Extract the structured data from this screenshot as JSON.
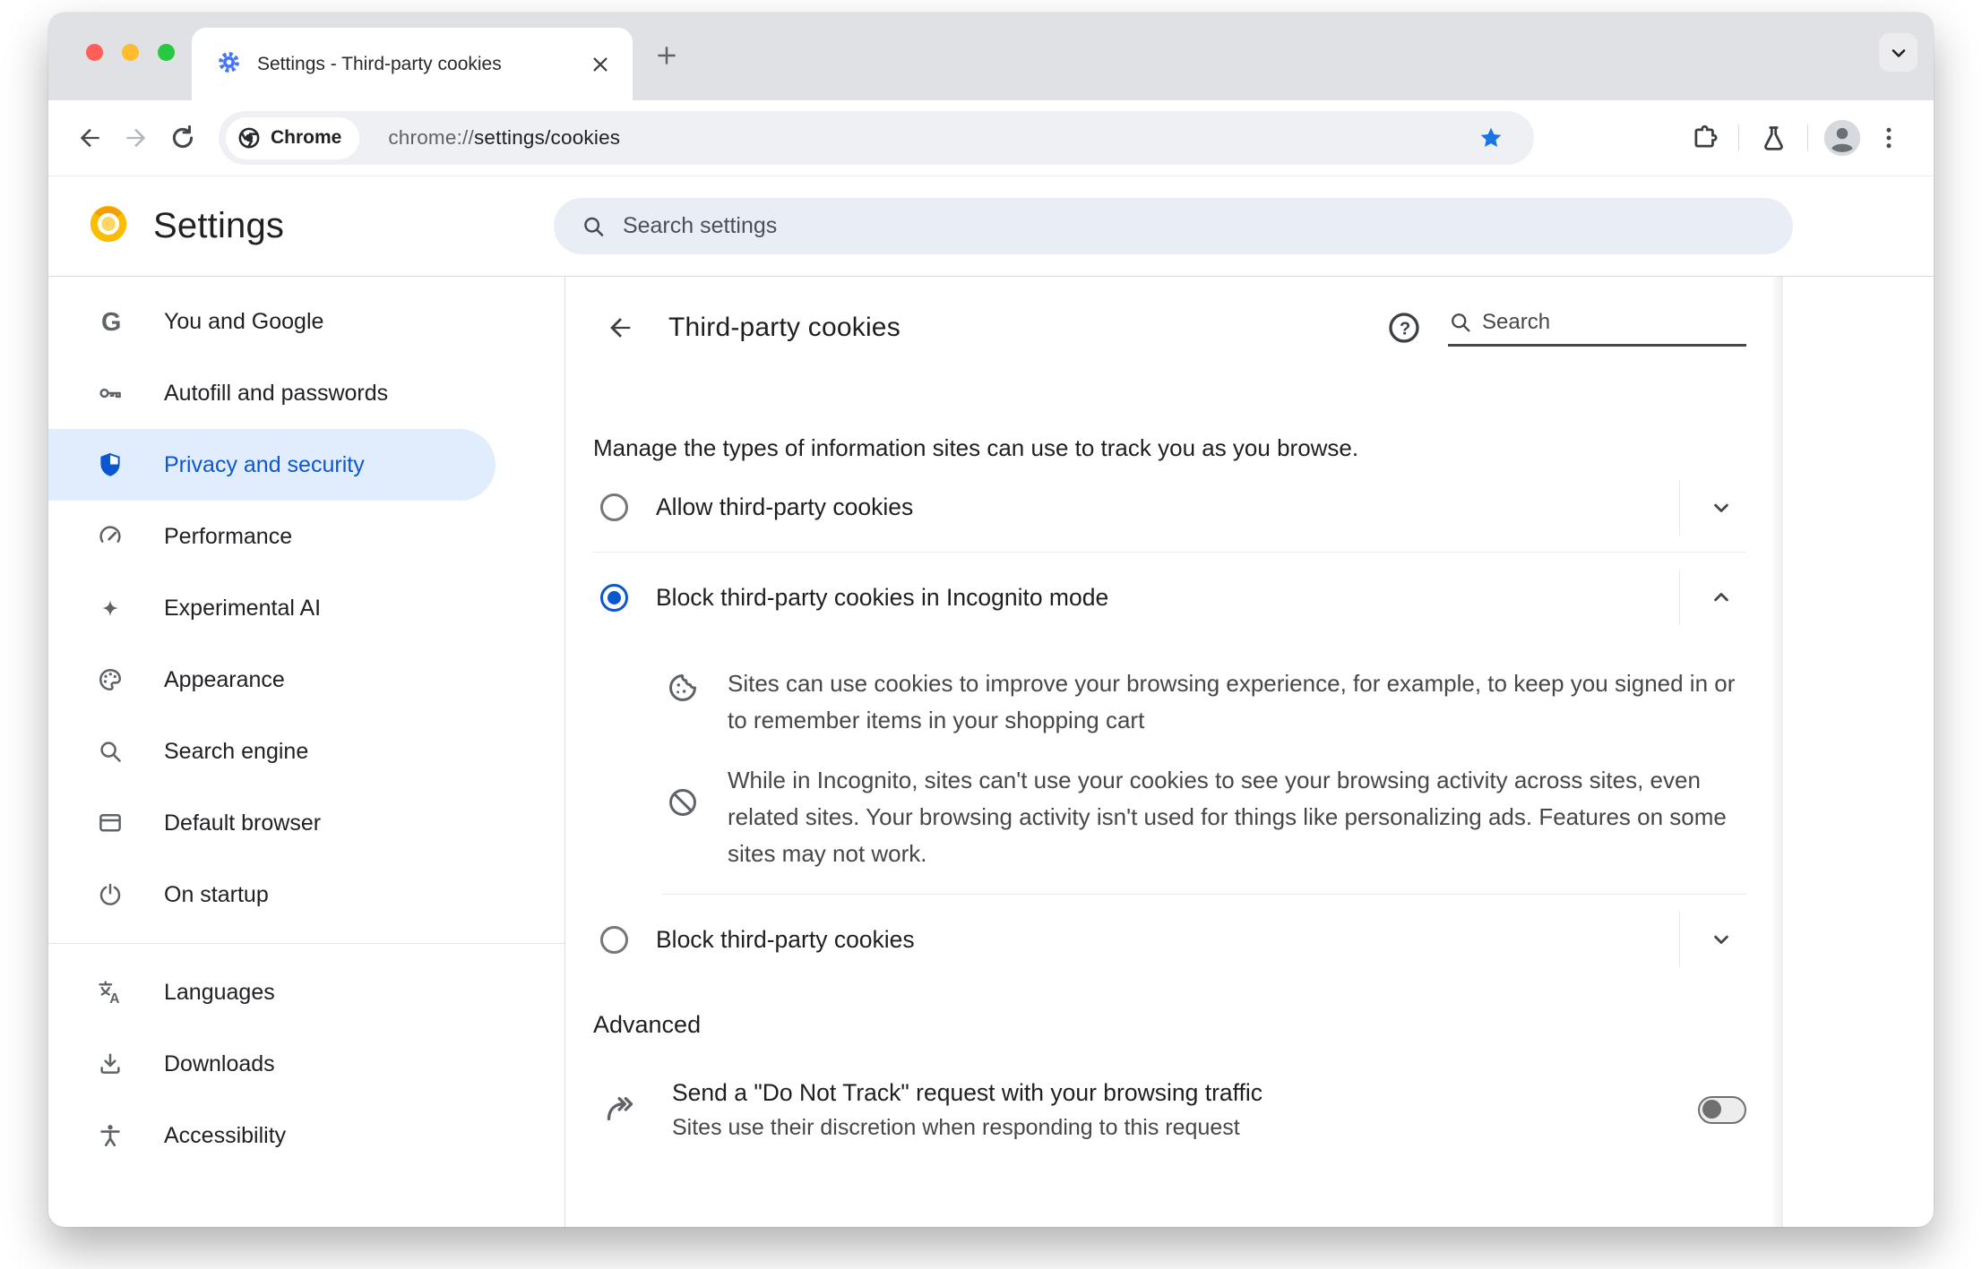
{
  "browser": {
    "tab_title": "Settings - Third-party cookies",
    "chrome_chip_label": "Chrome",
    "url_scheme": "chrome://",
    "url_path": "settings/cookies"
  },
  "settings_header": {
    "title": "Settings",
    "search_placeholder": "Search settings"
  },
  "sidebar": {
    "items": [
      {
        "label": "You and Google"
      },
      {
        "label": "Autofill and passwords"
      },
      {
        "label": "Privacy and security"
      },
      {
        "label": "Performance"
      },
      {
        "label": "Experimental AI"
      },
      {
        "label": "Appearance"
      },
      {
        "label": "Search engine"
      },
      {
        "label": "Default browser"
      },
      {
        "label": "On startup"
      },
      {
        "label": "Languages"
      },
      {
        "label": "Downloads"
      },
      {
        "label": "Accessibility"
      }
    ]
  },
  "panel": {
    "title": "Third-party cookies",
    "search_placeholder": "Search",
    "intro": "Manage the types of information sites can use to track you as you browse.",
    "options": [
      {
        "label": "Allow third-party cookies"
      },
      {
        "label": "Block third-party cookies in Incognito mode"
      },
      {
        "label": "Block third-party cookies"
      }
    ],
    "details": [
      {
        "text": "Sites can use cookies to improve your browsing experience, for example, to keep you signed in or to remember items in your shopping cart"
      },
      {
        "text": "While in Incognito, sites can't use your cookies to see your browsing activity across sites, even related sites. Your browsing activity isn't used for things like personalizing ads. Features on some sites may not work."
      }
    ],
    "advanced_label": "Advanced",
    "dnt": {
      "title": "Send a \"Do Not Track\" request with your browsing traffic",
      "subtitle": "Sites use their discretion when responding to this request"
    }
  },
  "colors": {
    "accent_blue": "#0b57d0",
    "favicon_blue": "#4775f2",
    "star_blue": "#1a73e8",
    "selected_pill": "#e1ecfd",
    "traffic_red": "#ff5f57",
    "traffic_yellow": "#febc2e",
    "traffic_green": "#28c840"
  }
}
